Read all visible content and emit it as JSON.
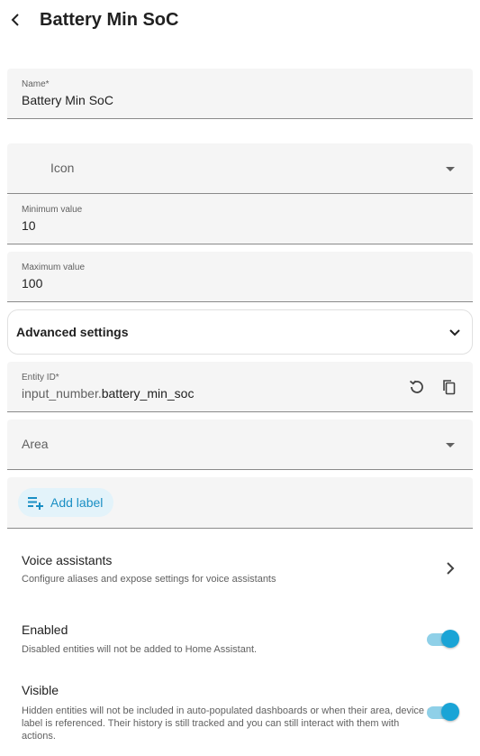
{
  "header": {
    "title": "Battery Min SoC"
  },
  "form": {
    "name_label": "Name*",
    "name_value": "Battery Min SoC",
    "icon_placeholder": "Icon",
    "min_label": "Minimum value",
    "min_value": "10",
    "max_label": "Maximum value",
    "max_value": "100",
    "advanced_label": "Advanced settings",
    "entity_id_label": "Entity ID*",
    "entity_id_prefix": "input_number.",
    "entity_id_suffix": "battery_min_soc",
    "area_placeholder": "Area",
    "add_label": "Add label"
  },
  "voice": {
    "title": "Voice assistants",
    "description": "Configure aliases and expose settings for voice assistants"
  },
  "enabled": {
    "title": "Enabled",
    "description": "Disabled entities will not be added to Home Assistant.",
    "on": true
  },
  "visible": {
    "title": "Visible",
    "description": "Hidden entities will not be included in auto-populated dashboards or when their area, device or label is referenced. Their history is still tracked and you can still interact with them with actions.",
    "on": true
  },
  "colors": {
    "accent": "#1aa4d6",
    "accent_track": "#8fd0e8",
    "chip_bg": "#e3f3fa",
    "chip_text": "#1a8fc4"
  }
}
